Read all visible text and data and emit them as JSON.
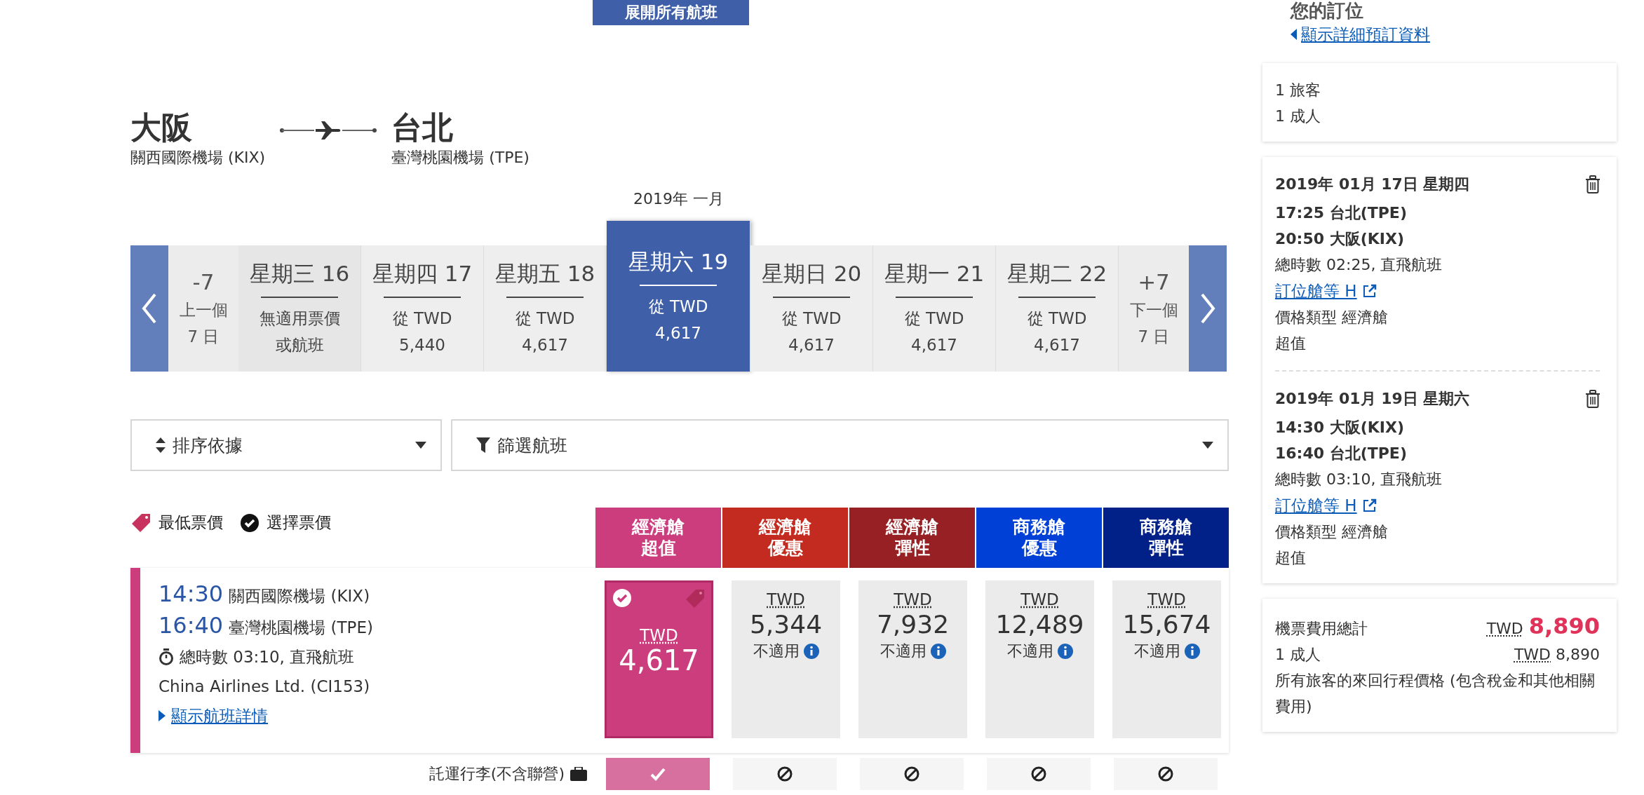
{
  "expand_button": "展開所有航班",
  "route": {
    "origin": {
      "city": "大阪",
      "airport": "關西國際機場 (KIX)"
    },
    "destination": {
      "city": "台北",
      "airport": "臺灣桃園機場 (TPE)"
    }
  },
  "calendar": {
    "month": "2019年 一月",
    "prev": {
      "label": "-7",
      "line1": "上一個",
      "line2": "7 日"
    },
    "days": [
      {
        "kind": "unavailable",
        "day": "星期三 16",
        "lines": [
          "無適用票價",
          "或航班"
        ],
        "selected": false
      },
      {
        "kind": "fare",
        "day": "星期四 17",
        "from": "從 TWD",
        "price": "5,440",
        "selected": false
      },
      {
        "kind": "fare",
        "day": "星期五 18",
        "from": "從 TWD",
        "price": "4,617",
        "selected": false
      },
      {
        "kind": "fare",
        "day": "星期六 19",
        "from": "從 TWD",
        "price": "4,617",
        "selected": true
      },
      {
        "kind": "fare",
        "day": "星期日 20",
        "from": "從 TWD",
        "price": "4,617",
        "selected": false
      },
      {
        "kind": "fare",
        "day": "星期一 21",
        "from": "從 TWD",
        "price": "4,617",
        "selected": false
      },
      {
        "kind": "fare",
        "day": "星期二 22",
        "from": "從 TWD",
        "price": "4,617",
        "selected": false
      }
    ],
    "next": {
      "label": "+7",
      "line1": "下一個",
      "line2": "7 日"
    }
  },
  "sort": {
    "label": "排序依據"
  },
  "filter": {
    "label": "篩選航班"
  },
  "legend": {
    "lowest": "最低票價",
    "selected": "選擇票價"
  },
  "fare_columns": [
    {
      "line1": "經濟艙",
      "line2": "超值",
      "color": "#cc3d7e"
    },
    {
      "line1": "經濟艙",
      "line2": "優惠",
      "color": "#c42b20"
    },
    {
      "line1": "經濟艙",
      "line2": "彈性",
      "color": "#962023"
    },
    {
      "line1": "商務艙",
      "line2": "優惠",
      "color": "#0040d6"
    },
    {
      "line1": "商務艙",
      "line2": "彈性",
      "color": "#012189"
    }
  ],
  "flight": {
    "depart_time": "14:30",
    "depart_airport": "關西國際機場 (KIX)",
    "arrive_time": "16:40",
    "arrive_airport": "臺灣桃園機場 (TPE)",
    "duration": "總時數 03:10, 直飛航班",
    "carrier": "China Airlines Ltd. (CI153)",
    "details_link": "顯示航班詳情",
    "fares": [
      {
        "currency": "TWD",
        "price": "4,617",
        "selected": true,
        "lowest": true
      },
      {
        "currency": "TWD",
        "price": "5,344",
        "note": "不適用",
        "selected": false,
        "lowest": false
      },
      {
        "currency": "TWD",
        "price": "7,932",
        "note": "不適用",
        "selected": false,
        "lowest": false
      },
      {
        "currency": "TWD",
        "price": "12,489",
        "note": "不適用",
        "selected": false,
        "lowest": false
      },
      {
        "currency": "TWD",
        "price": "15,674",
        "note": "不適用",
        "selected": false,
        "lowest": false
      }
    ]
  },
  "baggage": {
    "label": "託運行李(不含聯營)",
    "included": [
      true,
      false,
      false,
      false,
      false
    ]
  },
  "sidebar": {
    "title": "您的訂位",
    "details_link": "顯示詳細預訂資料",
    "passengers": [
      "1 旅客",
      "1 成人"
    ],
    "segments": [
      {
        "date": "2019年 01月 17日 星期四",
        "depart": "17:25 台北(TPE)",
        "arrive": "20:50 大阪(KIX)",
        "duration": "總時數 02:25, 直飛航班",
        "booking_class": "訂位艙等 H",
        "fare_type": "價格類型 經濟艙",
        "fare_name": "超值"
      },
      {
        "date": "2019年 01月 19日 星期六",
        "depart": "14:30 大阪(KIX)",
        "arrive": "16:40 台北(TPE)",
        "duration": "總時數 03:10, 直飛航班",
        "booking_class": "訂位艙等 H",
        "fare_type": "價格類型 經濟艙",
        "fare_name": "超值"
      }
    ],
    "total": {
      "label": "機票費用總計",
      "currency": "TWD",
      "amount": "8,890",
      "rows": [
        {
          "label": "1 成人",
          "currency": "TWD",
          "amount": "8,890"
        }
      ],
      "note": "所有旅客的來回行程價格 (包含稅金和其他相關費用)"
    }
  }
}
